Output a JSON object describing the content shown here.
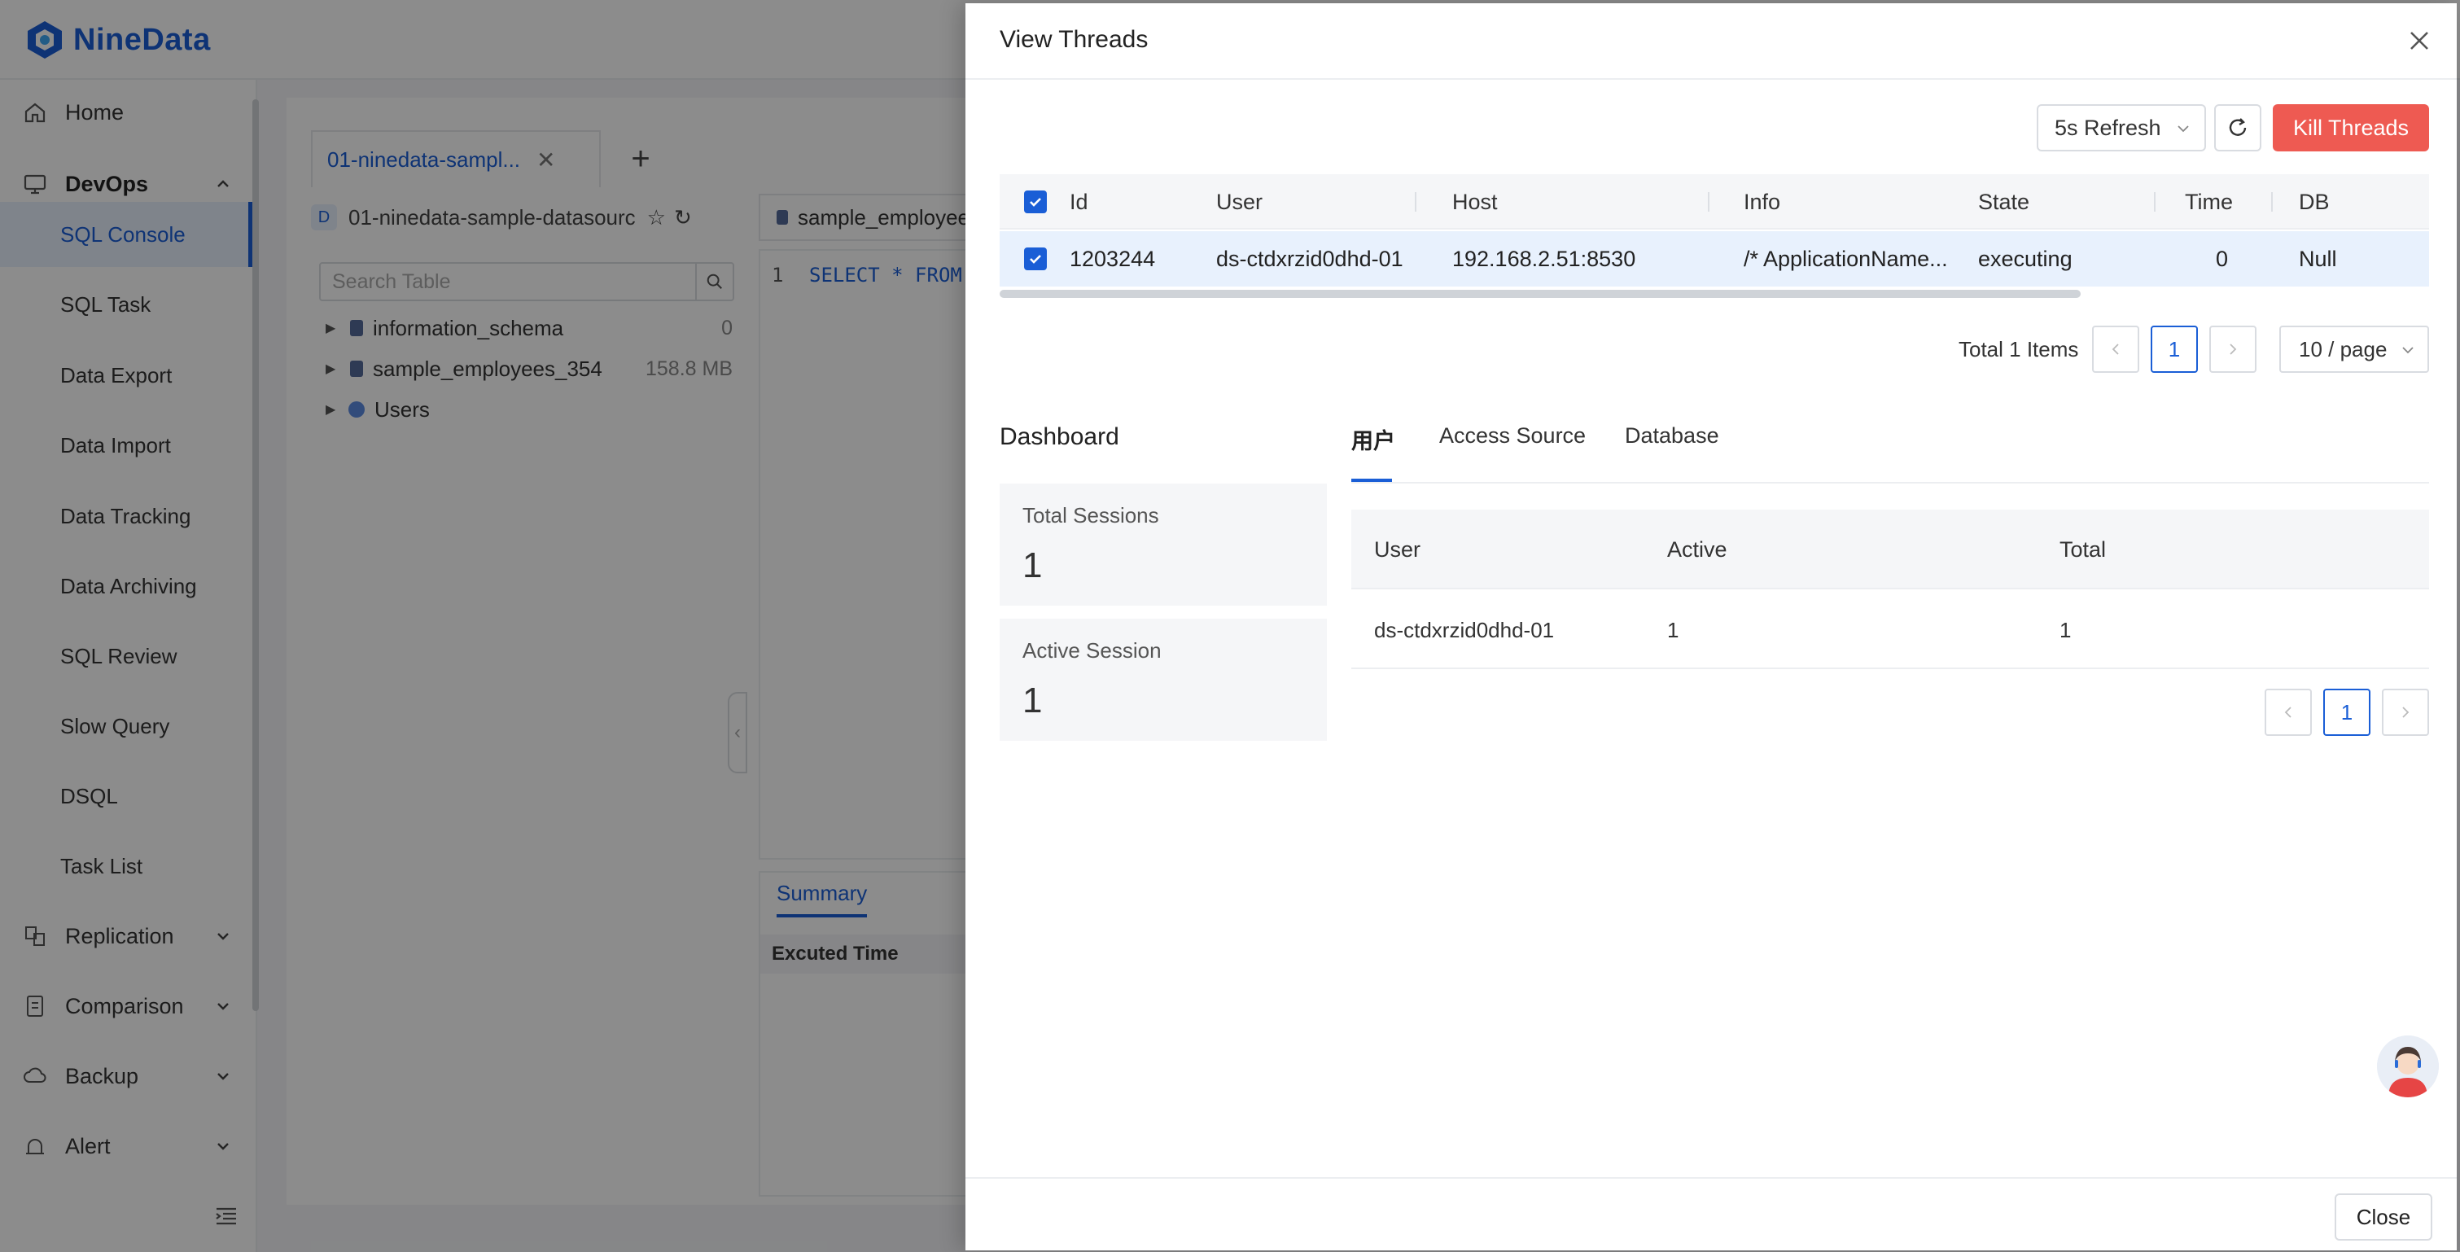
{
  "app": {
    "brand": "NineData",
    "sidebar": {
      "home": "Home",
      "devops": "DevOps",
      "devops_items": [
        "SQL Console",
        "SQL Task",
        "Data Export",
        "Data Import",
        "Data Tracking",
        "Data Archiving",
        "SQL Review",
        "Slow Query",
        "DSQL",
        "Task List"
      ],
      "active_item": "SQL Console",
      "replication": "Replication",
      "comparison": "Comparison",
      "backup": "Backup",
      "alert": "Alert"
    },
    "workspace": {
      "tab_label": "01-ninedata-sampl...",
      "datasource_badge": "D",
      "datasource": "01-ninedata-sample-datasourc",
      "search_placeholder": "Search Table",
      "tree": [
        {
          "name": "information_schema",
          "size": "0"
        },
        {
          "name": "sample_employees_354",
          "size": "158.8 MB"
        },
        {
          "name": "Users",
          "size": ""
        }
      ],
      "editor_tab": "sample_employee",
      "line_number": "1",
      "code": "SELECT * FROM",
      "result_tab": "Summary",
      "result_header": "Excuted Time"
    }
  },
  "drawer": {
    "title": "View Threads",
    "refresh_select": "5s Refresh",
    "kill_button": "Kill Threads",
    "table": {
      "columns": [
        "Id",
        "User",
        "Host",
        "Info",
        "State",
        "Time",
        "DB"
      ],
      "rows": [
        {
          "id": "1203244",
          "user": "ds-ctdxrzid0dhd-01",
          "host": "192.168.2.51:8530",
          "info": "/* ApplicationName...",
          "state": "executing",
          "time": "0",
          "db": "Null"
        }
      ]
    },
    "pagination": {
      "total": "Total 1 Items",
      "current_page": "1",
      "page_size": "10 / page"
    },
    "dashboard": {
      "title": "Dashboard",
      "total_sessions_label": "Total Sessions",
      "total_sessions_value": "1",
      "active_session_label": "Active Session",
      "active_session_value": "1",
      "tabs": [
        "用户",
        "Access Source",
        "Database"
      ],
      "active_tab": "用户",
      "user_table": {
        "columns": [
          "User",
          "Active",
          "Total"
        ],
        "rows": [
          {
            "user": "ds-ctdxrzid0dhd-01",
            "active": "1",
            "total": "1"
          }
        ]
      },
      "current_page": "1"
    },
    "close_button": "Close"
  },
  "colors": {
    "primary": "#1a5ed6",
    "danger": "#ee5a52",
    "selected_row": "#e8f1fd"
  }
}
